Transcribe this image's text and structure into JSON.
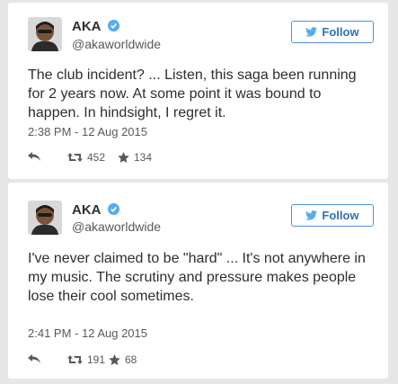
{
  "tweets": [
    {
      "author_name": "AKA",
      "author_handle": "@akaworldwide",
      "follow_label": "Follow",
      "text": "The club incident? ... Listen, this saga been running for 2 years now. At some point it was bound to happen. In hindsight, I regret it.",
      "timestamp": "2:38 PM - 12 Aug 2015",
      "retweets": "452",
      "favorites": "134"
    },
    {
      "author_name": "AKA",
      "author_handle": "@akaworldwide",
      "follow_label": "Follow",
      "text": "I've never claimed to be \"hard\" ... It's not anywhere in my music. The scrutiny and pressure makes people lose their cool sometimes.",
      "timestamp": "2:41 PM - 12 Aug 2015",
      "retweets": "191",
      "favorites": "68"
    }
  ],
  "icons": {
    "verified": "verified-badge-icon",
    "bird": "twitter-bird-icon",
    "reply": "reply-icon",
    "retweet": "retweet-icon",
    "favorite": "star-icon"
  },
  "colors": {
    "accent": "#4f8fd8",
    "verified": "#55acee",
    "text": "#292f33",
    "secondary": "#555a5e"
  }
}
